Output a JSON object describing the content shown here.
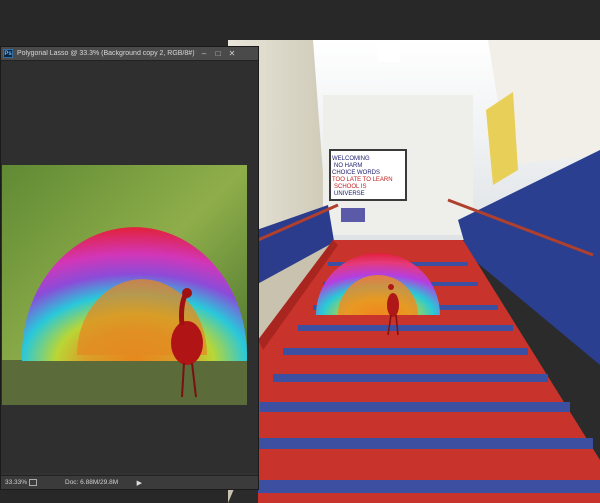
{
  "window": {
    "title": "Polygonal Lasso @ 33.3% (Background copy 2, RGB/8#) *",
    "app_icon_label": "Ps",
    "buttons": {
      "minimize": "–",
      "maximize": "□",
      "close": "✕"
    }
  },
  "statusbar": {
    "zoom": "33.33%",
    "doc_info": "Doc: 6.88M/29.8M",
    "arrow": "▶"
  },
  "background_document": {
    "sign_lines": [
      "WELCOMING",
      "NO HARM",
      "CHOICE WORDS",
      "TOO LATE TO LEARN",
      "SCHOOL IS",
      "UNIVERSE"
    ]
  },
  "colors": {
    "stairs_red": "#c8332b",
    "stair_edge_blue": "#3d4fa0",
    "wall_blue": "#2a3f8f"
  }
}
